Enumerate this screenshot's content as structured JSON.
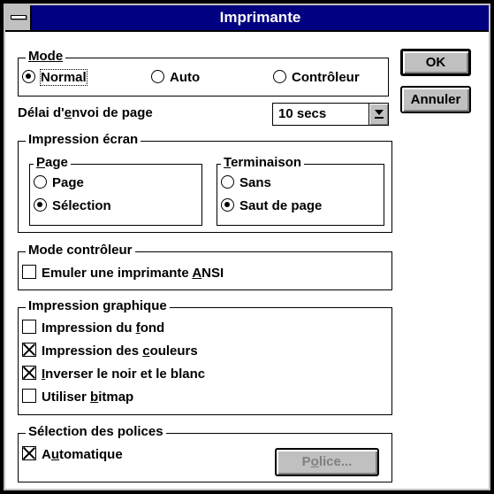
{
  "dialog": {
    "title": "Imprimante"
  },
  "mode": {
    "legend": "Mode",
    "options": [
      {
        "label": "Normal",
        "selected": true
      },
      {
        "label": "Auto",
        "selected": false
      },
      {
        "label": "Contrôleur",
        "selected": false
      }
    ]
  },
  "delay": {
    "label_pre": "Délai d'",
    "label_ul": "e",
    "label_post": "nvoi de page",
    "value": "10 secs"
  },
  "screen_print": {
    "legend": "Impression écran",
    "page": {
      "legend_ul": "P",
      "legend_rest": "age",
      "options": [
        {
          "label": "Page",
          "selected": false
        },
        {
          "label": "Sélection",
          "selected": true
        }
      ]
    },
    "termination": {
      "legend_ul": "T",
      "legend_rest": "erminaison",
      "options": [
        {
          "label": "Sans",
          "selected": false
        },
        {
          "label": "Saut de page",
          "selected": true
        }
      ]
    }
  },
  "controller_mode": {
    "legend": "Mode contrôleur",
    "emulate": {
      "pre": "Emuler une imprimante ",
      "ul": "A",
      "post": "NSI",
      "checked": false
    }
  },
  "graphics": {
    "legend": "Impression graphique",
    "background": {
      "pre": "Impression du ",
      "ul": "f",
      "post": "ond",
      "checked": false
    },
    "colors": {
      "pre": "Impression des ",
      "ul": "c",
      "post": "ouleurs",
      "checked": true
    },
    "invert": {
      "pre": "",
      "ul": "I",
      "post": "nverser le noir et le blanc",
      "checked": true
    },
    "bitmap": {
      "pre": "Utiliser ",
      "ul": "b",
      "post": "itmap",
      "checked": false
    }
  },
  "fonts": {
    "legend": "Sélection des polices",
    "auto": {
      "pre": "A",
      "ul": "u",
      "post": "tomatique",
      "checked": true
    },
    "button": {
      "pre": "P",
      "ul": "o",
      "post": "lice..."
    }
  },
  "buttons": {
    "ok": "OK",
    "cancel": "Annuler"
  }
}
